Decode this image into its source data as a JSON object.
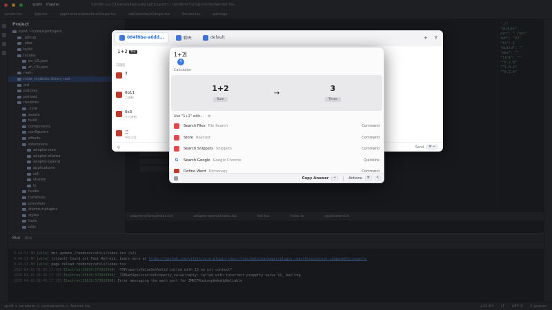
{
  "ide": {
    "title_project": "spirit",
    "title_branch": "master",
    "title_path": "Sender.tsx [/Users/yilia/code/spirit/spirit] - renderer/components/Sender.tsx",
    "editor_tabs": [
      "sender.tsx",
      "App.tsx",
      "applications/selectorsGroups.tsx",
      "cell/selectorsGroups.tsx",
      "Sender.tsx",
      "package"
    ],
    "project_header": "Project",
    "tree": [
      {
        "label": "spirit ~/code/spirit/spirit",
        "indent": 0
      },
      {
        "label": ".github",
        "indent": 1
      },
      {
        "label": ".idea",
        "indent": 1
      },
      {
        "label": "build",
        "indent": 1
      },
      {
        "label": "locales",
        "indent": 1
      },
      {
        "label": "en_US.json",
        "indent": 2
      },
      {
        "label": "zh_CN.json",
        "indent": 2
      },
      {
        "label": "main",
        "indent": 1
      },
      {
        "label": "node_modules library root",
        "indent": 1,
        "selected": true
      },
      {
        "label": "out",
        "indent": 1
      },
      {
        "label": "patches",
        "indent": 1
      },
      {
        "label": "preload",
        "indent": 1
      },
      {
        "label": "renderer",
        "indent": 1
      },
      {
        "label": ".core",
        "indent": 2
      },
      {
        "label": "assets",
        "indent": 2
      },
      {
        "label": "build",
        "indent": 2
      },
      {
        "label": "components",
        "indent": 2
      },
      {
        "label": "configurers",
        "indent": 2
      },
      {
        "label": "effects",
        "indent": 2
      },
      {
        "label": "extensions",
        "indent": 2
      },
      {
        "label": "adapter-core",
        "indent": 3
      },
      {
        "label": "adapter-ollama",
        "indent": 3
      },
      {
        "label": "adapter-openai",
        "indent": 3
      },
      {
        "label": "applications",
        "indent": 3
      },
      {
        "label": "cell",
        "indent": 3
      },
      {
        "label": "shared",
        "indent": 3
      },
      {
        "label": "ts",
        "indent": 3
      },
      {
        "label": "hooks",
        "indent": 2
      },
      {
        "label": "instances",
        "indent": 2
      },
      {
        "label": "providers",
        "indent": 2
      },
      {
        "label": "shortcut-plugins",
        "indent": 2
      },
      {
        "label": "styles",
        "indent": 2
      },
      {
        "label": "tools",
        "indent": 2
      },
      {
        "label": "utils",
        "indent": 2
      }
    ],
    "code_right": [
      "'./'",
      "\"module\"",
      "ain\": \"./out\"",
      "ion\": \"22\"",
      "\"ts\": {",
      "\"build\": \"\"",
      "\"dev\": \"\"",
      "\"lint\": \"\"",
      "\"^0.2.0\"",
      "\"^1.0.2\"",
      "\"^0.2.0\""
    ],
    "bottom_tabs": [
      "adapter-ollama/index.tsx",
      "adapter-openai/index.tsx",
      "bot.tsx",
      "index.ts",
      "applications.ts"
    ],
    "run_label": "Run",
    "run_config": "dev",
    "logs": [
      {
        "time": "4:44:13 AM",
        "tag": "[vite]",
        "text": "hmr update /renderer/utils/index.tsx (x2)"
      },
      {
        "time": "4:44:13 AM",
        "tag": "[vite]",
        "text": "(client) Could not Fast Refresh. Learn more at",
        "link": "https://github.com/vitejs/vite-plugin-react/tree/main/packages/plugin-react#consistent-components-exports"
      },
      {
        "time": "4:44:13 AM",
        "tag": "[vite]",
        "text": "page reload renderer/utils/index.tsx"
      },
      {
        "time": "2025-04-16 01:45:17.783",
        "tag": "Electron[35819:573913998]",
        "text": "-TSPropertyValueSetValid called with 13 on nil context?"
      },
      {
        "time": "2025-04-16 01:45:17.783",
        "tag": "Electron[35819:573913998]",
        "text": "_TSMGetApplicationProperty_value:reply: called with incorrect property value 92, bailing."
      },
      {
        "time": "2025-04-16 01:45:17.783",
        "tag": "Electron[35819:573913998]",
        "text": "Error messaging the mach port for IMKCFRunLoopWakeUpReliable"
      }
    ],
    "status_breadcrumb": "spirit > renderer > components > Sender.tsx",
    "status_right": [
      "415:67",
      "LF",
      "UTF-8",
      "2 spaces"
    ]
  },
  "app": {
    "tabs": [
      {
        "label": "084f8be-a6dd...",
        "active": true
      },
      {
        "label": "聊天",
        "active": false
      },
      {
        "label": "default",
        "active": false
      }
    ],
    "add_label": "+",
    "filter_label": "Y",
    "input_text": "1+2",
    "you_badge": "You",
    "list_header": "日期前",
    "items": [
      {
        "title": "3",
        "sub": ""
      },
      {
        "title": "0b11",
        "sub": "二进制"
      },
      {
        "title": "0x3",
        "sub": "十六进制"
      },
      {
        "title": "三",
        "sub": "中文小写"
      }
    ],
    "footer_left": "◎",
    "footer_send": "Send",
    "footer_kbd": "⌘ ↵"
  },
  "raycast": {
    "query": "1+2",
    "ai_badge": "A",
    "section_calculator": "Calculator",
    "calc_input": "1+2",
    "calc_input_label": "Sum",
    "calc_arrow": "→",
    "calc_output": "3",
    "calc_output_label": "Three",
    "use_with": "Use \"1+2\" with...",
    "use_with_icon": "⚙",
    "rows": [
      {
        "title": "Search Files",
        "subtitle": "File Search",
        "kind": "Command",
        "color": "#e5484d"
      },
      {
        "title": "Store",
        "subtitle": "Raycast",
        "kind": "Command",
        "color": "#e5484d"
      },
      {
        "title": "Search Snippets",
        "subtitle": "Snippets",
        "kind": "Command",
        "color": "#e5484d"
      },
      {
        "title": "Search Google",
        "subtitle": "Google Chrome",
        "kind": "Quicklink",
        "color": "#ffffff",
        "glyph": "G"
      },
      {
        "title": "Define Word",
        "subtitle": "Dictionary",
        "kind": "Command",
        "color": "#c0392b"
      }
    ],
    "footer_copy": "Copy Answer",
    "footer_copy_kbd": "↵",
    "footer_actions": "Actions",
    "footer_actions_kbd": "⌘",
    "footer_actions_kbd2": "K"
  }
}
